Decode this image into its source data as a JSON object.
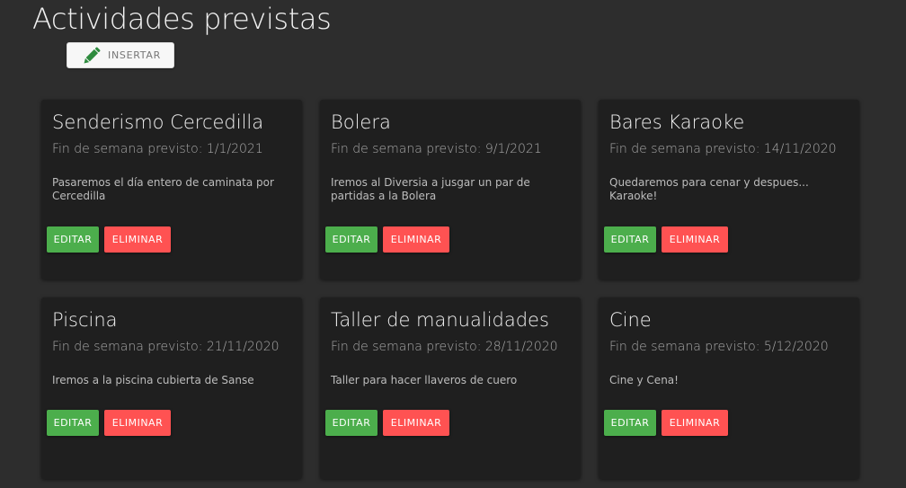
{
  "page": {
    "title": "Actividades previstas",
    "insert_label": "INSERTAR"
  },
  "colors": {
    "background": "#2d2d2d",
    "card": "#1f1f1f",
    "edit_button": "#4cae4c",
    "delete_button": "#ff5252",
    "pencil_icon": "#2e8b3e"
  },
  "icons": {
    "insert": "pencil-icon"
  },
  "cards": [
    {
      "title": "Senderismo Cercedilla",
      "subtitle": "Fin de semana previsto: 1/1/2021",
      "description": "Pasaremos el día entero de caminata por Cercedilla",
      "edit_label": "EDITAR",
      "delete_label": "ELIMINAR"
    },
    {
      "title": "Bolera",
      "subtitle": "Fin de semana previsto: 9/1/2021",
      "description": "Iremos al Diversia a jusgar un par de partidas a la Bolera",
      "edit_label": "EDITAR",
      "delete_label": "ELIMINAR"
    },
    {
      "title": "Bares Karaoke",
      "subtitle": "Fin de semana previsto: 14/11/2020",
      "description": "Quedaremos para cenar y despues... Karaoke!",
      "edit_label": "EDITAR",
      "delete_label": "ELIMINAR"
    },
    {
      "title": "Piscina",
      "subtitle": "Fin de semana previsto: 21/11/2020",
      "description": "Iremos a la piscina cubierta de Sanse",
      "edit_label": "EDITAR",
      "delete_label": "ELIMINAR"
    },
    {
      "title": "Taller de manualidades",
      "subtitle": "Fin de semana previsto: 28/11/2020",
      "description": "Taller para hacer llaveros de cuero",
      "edit_label": "EDITAR",
      "delete_label": "ELIMINAR"
    },
    {
      "title": "Cine",
      "subtitle": "Fin de semana previsto: 5/12/2020",
      "description": "Cine y Cena!",
      "edit_label": "EDITAR",
      "delete_label": "ELIMINAR"
    }
  ]
}
